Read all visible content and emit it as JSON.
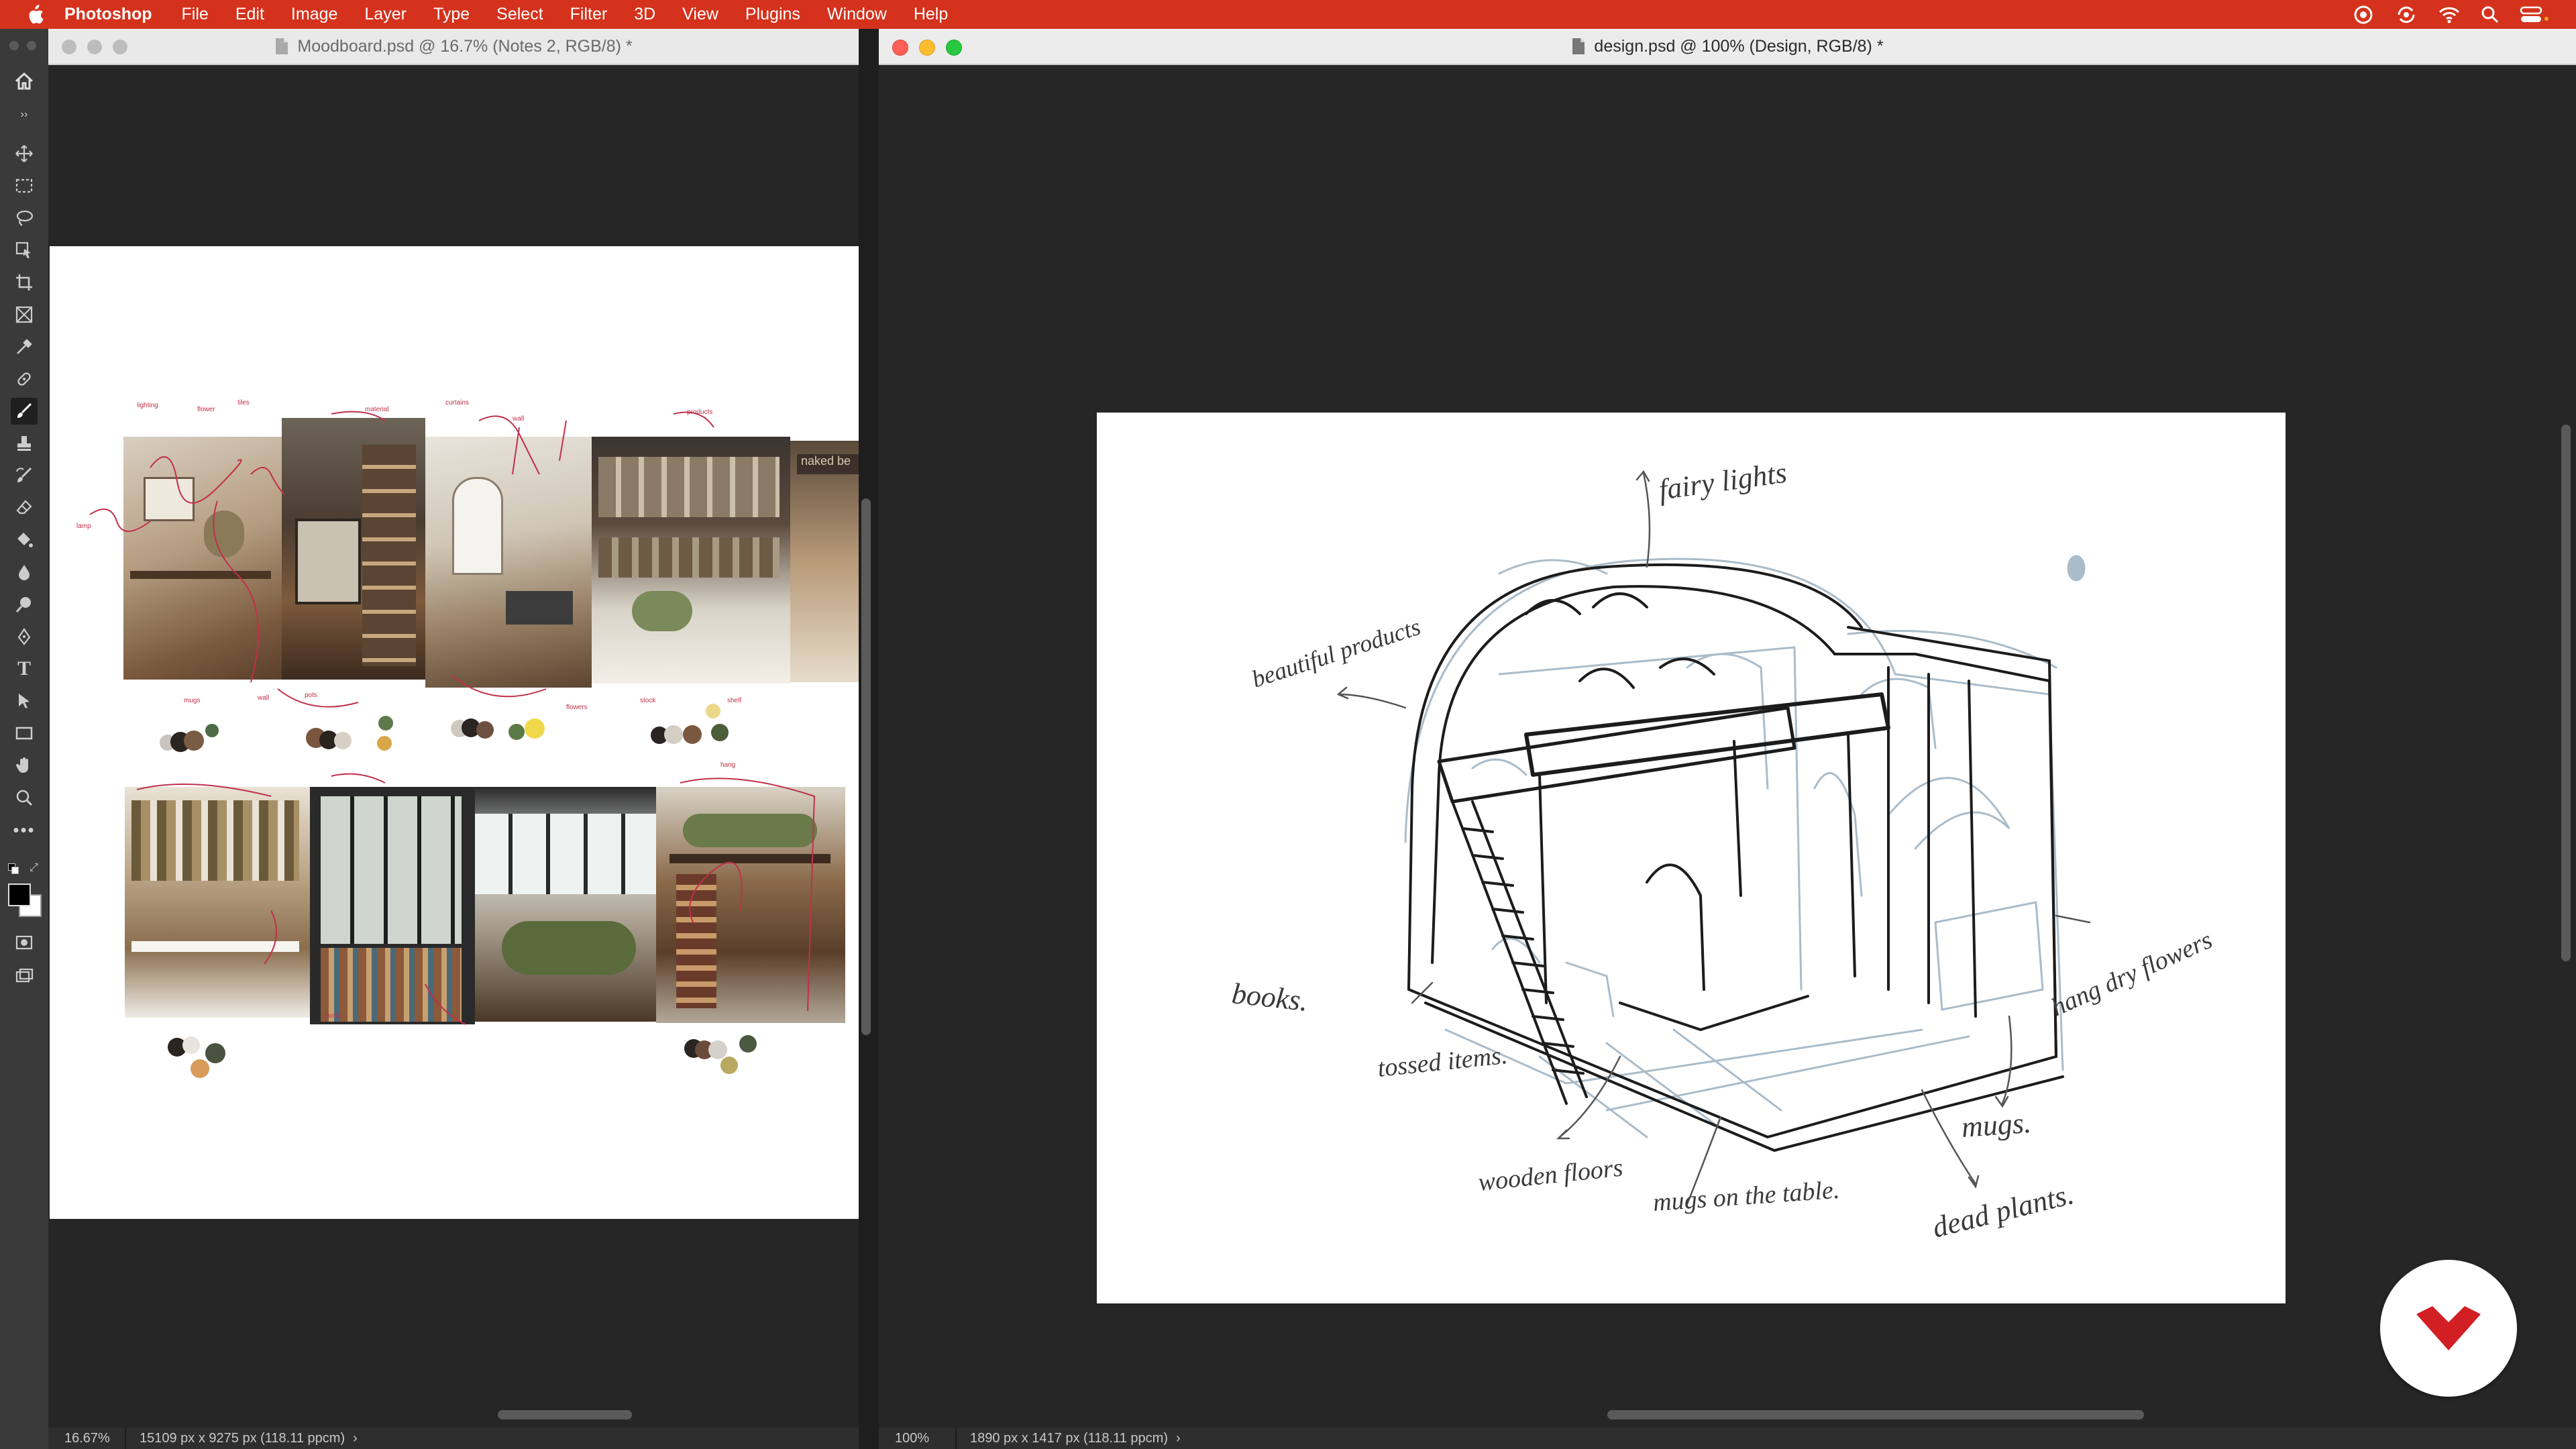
{
  "menubar": {
    "items": [
      "Photoshop",
      "File",
      "Edit",
      "Image",
      "Layer",
      "Type",
      "Select",
      "Filter",
      "3D",
      "View",
      "Plugins",
      "Window",
      "Help"
    ],
    "status_icons": [
      "creative-cloud-icon",
      "sync-icon",
      "wifi-icon",
      "search-icon",
      "control-center-icon"
    ],
    "accent": "#d4321c"
  },
  "toolbar": {
    "tools": [
      "move-tool-icon",
      "marquee-tool-icon",
      "lasso-tool-icon",
      "object-select-tool-icon",
      "crop-tool-icon",
      "frame-tool-icon",
      "eyedropper-tool-icon",
      "healing-brush-icon",
      "brush-tool-icon",
      "stamp-tool-icon",
      "history-brush-icon",
      "eraser-tool-icon",
      "paint-bucket-icon",
      "blur-tool-icon",
      "dodge-tool-icon",
      "pen-tool-icon",
      "type-tool-icon",
      "path-select-icon",
      "rectangle-tool-icon",
      "hand-tool-icon",
      "zoom-tool-icon",
      "more-tools-icon"
    ],
    "active_tool": "brush-tool-icon",
    "foreground": "#000000",
    "background": "#ffffff"
  },
  "left_doc": {
    "title": "Moodboard.psd @ 16.7% (Notes 2, RGB/8) *",
    "zoom": "16.67%",
    "info": "15109 px x 9275 px (118.11 ppcm)"
  },
  "right_doc": {
    "title": "design.psd @ 100% (Design, RGB/8) *",
    "zoom": "100%",
    "info": "1890 px x 1417 px (118.11 ppcm)",
    "sketch_notes": [
      "fairy lights",
      "beautiful products",
      "books.",
      "tossed items.",
      "wooden floors",
      "mugs on the table.",
      "dead plants.",
      "mugs.",
      "hang dry flowers"
    ]
  }
}
